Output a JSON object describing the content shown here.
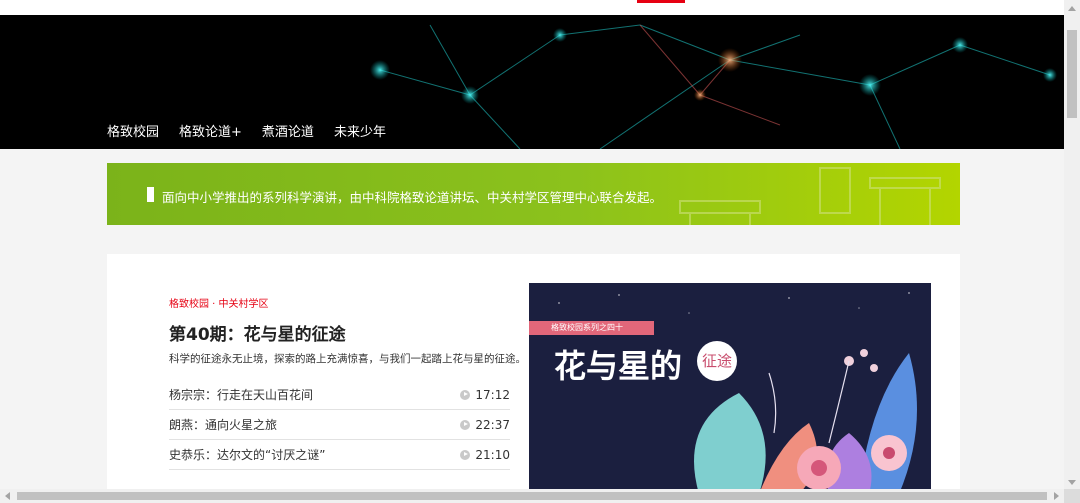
{
  "nav": {
    "items": [
      {
        "label": "格致校园",
        "active": true
      },
      {
        "label": "格致论道+",
        "active": false
      },
      {
        "label": "煮酒论道",
        "active": false
      },
      {
        "label": "未来少年",
        "active": false
      }
    ]
  },
  "banner": {
    "text": "面向中小学推出的系列科学演讲，由中科院格致论道讲坛、中关村学区管理中心联合发起。"
  },
  "episode": {
    "tag": "格致校园 · 中关村学区",
    "title": "第40期：花与星的征途",
    "description": "科学的征途永无止境，探索的路上充满惊喜，与我们一起踏上花与星的征途。",
    "talks": [
      {
        "name": "杨宗宗：行走在天山百花间",
        "duration": "17:12"
      },
      {
        "name": "朗燕：通向火星之旅",
        "duration": "22:37"
      },
      {
        "name": "史恭乐：达尔文的“讨厌之谜”",
        "duration": "21:10"
      }
    ]
  },
  "poster": {
    "ribbon": "格致校园系列之四十",
    "title": "花与星的",
    "circle": "征途"
  },
  "colors": {
    "accent": "#e60012",
    "banner_green": "#8cc21c",
    "hero_bg": "#000000"
  }
}
